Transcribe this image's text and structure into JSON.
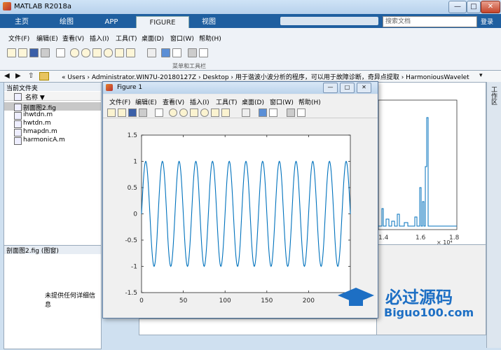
{
  "app": {
    "title": "MATLAB R2018a"
  },
  "window_controls": {
    "minimize": "—",
    "maximize": "□",
    "close": "✕"
  },
  "ribbon_tabs": [
    {
      "label": "主页"
    },
    {
      "label": "绘图"
    },
    {
      "label": "APP"
    },
    {
      "label": "FIGURE"
    },
    {
      "label": "视图"
    }
  ],
  "search": {
    "placeholder": "搜索文档"
  },
  "login": "登录",
  "menu": [
    "文件(F)",
    "编辑(E)",
    "查看(V)",
    "插入(I)",
    "工具(T)",
    "桌面(D)",
    "窗口(W)",
    "帮助(H)"
  ],
  "ribbon_group_label": "菜单和工具栏",
  "address": {
    "path": "« Users › Administrator.WIN7U-20180127Z › Desktop › 用于谐波小波分析的程序，可以用于故障诊断，奇异点提取 › HarmoniousWavelet"
  },
  "left_panel": {
    "title": "当前文件夹",
    "column_header": "名称 ▼",
    "files": [
      "剖面图2.fig",
      "ihwtdn.m",
      "hwtdn.m",
      "hmapdn.m",
      "harmonicA.m"
    ],
    "details_title": "剖面图2.fig (图窗)",
    "details_text": "未提供任何详细信息"
  },
  "side_tab": "工作区",
  "background_plot": {
    "x_ticks": [
      "1.4",
      "1.6",
      "1.8"
    ],
    "x_exponent": "× 10⁴"
  },
  "figure": {
    "title": "Figure 1",
    "menu": [
      "文件(F)",
      "编辑(E)",
      "查看(V)",
      "插入(I)",
      "工具(T)",
      "桌面(D)",
      "窗口(W)",
      "帮助(H)"
    ]
  },
  "chart_data": {
    "type": "line",
    "title": "",
    "xlabel": "",
    "ylabel": "",
    "xlim": [
      0,
      250
    ],
    "ylim": [
      -1.5,
      1.5
    ],
    "x_ticks": [
      0,
      50,
      100,
      150,
      200
    ],
    "x_tick_labels": [
      "0",
      "50",
      "100",
      "150",
      "200"
    ],
    "y_ticks": [
      1.5,
      1,
      0.5,
      0,
      -0.5,
      -1,
      -1.5
    ],
    "y_tick_labels": [
      "1.5",
      "1",
      "0.5",
      "0",
      "-0.5",
      "-1",
      "-1.5"
    ],
    "series": [
      {
        "function": "sin",
        "amplitude": 1,
        "period": 20,
        "x_start": 0,
        "x_end": 250,
        "color": "#0072BD"
      }
    ],
    "grid": false
  },
  "watermark": {
    "main": "必过源码",
    "sub": "Biguo100.com"
  }
}
